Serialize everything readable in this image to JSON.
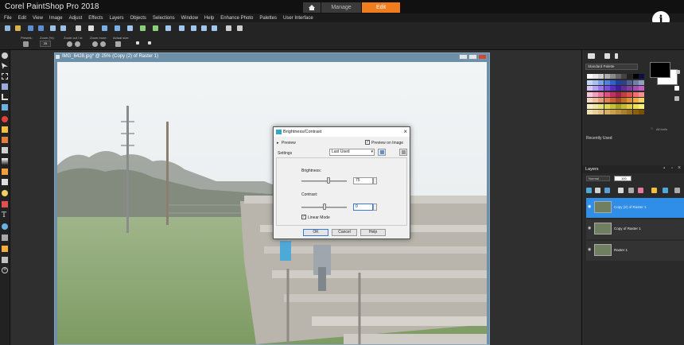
{
  "app": {
    "title": "Corel PaintShop Pro 2018",
    "tabs": {
      "manage": "Manage",
      "edit": "Edit"
    }
  },
  "menu": [
    "File",
    "Edit",
    "View",
    "Image",
    "Adjust",
    "Effects",
    "Layers",
    "Objects",
    "Selections",
    "Window",
    "Help",
    "Enhance Photo",
    "Palettes",
    "User Interface"
  ],
  "options_bar": {
    "presets_label": "Presets:",
    "zoom_label": "Zoom (%):",
    "zoom_value": "25",
    "zoom_in_out_label": "Zoom out / in:",
    "zoom_more_label": "Zoom more:",
    "actual_size_label": "Actual size:"
  },
  "document": {
    "title": "IMG_6428.jpg* @  25% (Copy (2) of Raster 1)"
  },
  "dialog": {
    "title": "Brightness/Contrast",
    "preview_toggle": "Preview",
    "preview_on_image": "Preview on Image",
    "settings_label": "Settings",
    "settings_value": "Last Used",
    "brightness_label": "Brightness:",
    "brightness_value": "75",
    "brightness_fraction": 0.6,
    "contrast_label": "Contrast:",
    "contrast_value": "0",
    "contrast_fraction": 0.5,
    "linear_mode": "Linear Mode",
    "ok": "OK",
    "cancel": "Cancel",
    "help": "Help"
  },
  "palette_panel": {
    "palette_name": "Standard Palette",
    "all_tools": "All tools",
    "recently_used": "Recently Used"
  },
  "layers_panel": {
    "title": "Layers",
    "blend_mode": "Normal",
    "opacity": "100",
    "layers": [
      "Copy (2) of Raster 1",
      "Copy of Raster 1",
      "Raster 1"
    ]
  },
  "colors": {
    "accent": "#f07c1e",
    "selected_layer": "#2e8ee8"
  }
}
